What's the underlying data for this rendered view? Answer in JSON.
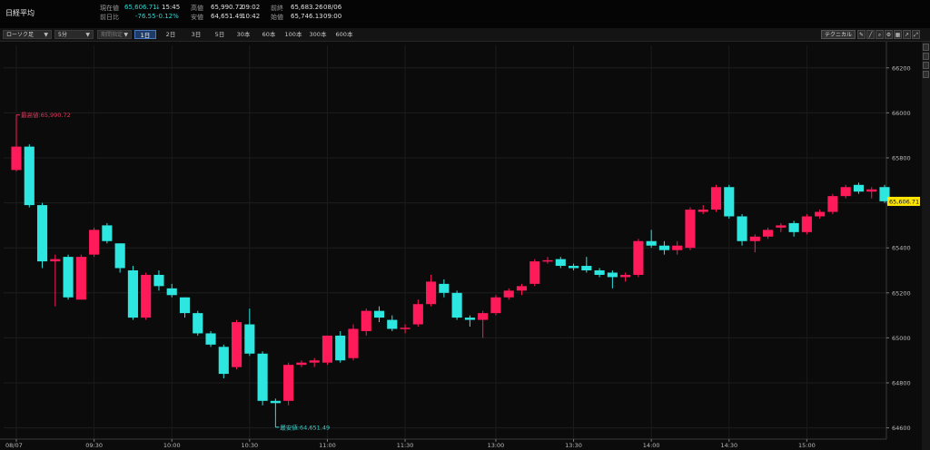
{
  "header": {
    "title": "日経平均",
    "current_label": "現在値",
    "current_value": "65,606.71",
    "current_arrow": "↓",
    "current_time": "15:45",
    "change_label": "前日比",
    "change_value": "-76.55",
    "change_pct": "-0.12%",
    "high_label": "高値",
    "high_value": "65,990.72",
    "high_time": "09:02",
    "low_label": "安値",
    "low_value": "64,651.49",
    "low_time": "10:42",
    "prev_label": "前終",
    "prev_value": "65,683.26",
    "prev_date": "08/06",
    "open_label": "始値",
    "open_value": "65,746.13",
    "open_time": "09:00"
  },
  "toolbar": {
    "chart_type": "ローソク足",
    "interval": "5分",
    "compare": "期間指定",
    "timeframes": [
      "1日",
      "2日",
      "3日",
      "5日",
      "30本",
      "60本",
      "100本",
      "300本",
      "600本"
    ],
    "active_timeframe": "1日",
    "technical_label": "テクニカル",
    "tool_icons": [
      "pencil-icon",
      "ruler-icon",
      "zoom-icon",
      "settings-icon",
      "bar-chart-icon",
      "line-chart-icon",
      "expand-icon"
    ]
  },
  "colors": {
    "up": "#ff1a5a",
    "down": "#2ee6e0",
    "background": "#0b0b0b",
    "price_label_bg": "#ffe600",
    "high_annotation": "#e4365c",
    "low_annotation": "#34d6d1"
  },
  "chart_data": {
    "type": "candlestick",
    "interval": "5分",
    "ylim": [
      64550,
      66300
    ],
    "yticks": [
      64600,
      64800,
      65000,
      65200,
      65400,
      65600,
      65800,
      66000,
      66200
    ],
    "ytick_labels": [
      "64600",
      "64800",
      "65000",
      "65200",
      "65400",
      "65600",
      "65800",
      "66000",
      "66200"
    ],
    "xtick_labels": [
      {
        "label": "08/07",
        "index": 0
      },
      {
        "label": "09:30",
        "index": 6
      },
      {
        "label": "10:00",
        "index": 12
      },
      {
        "label": "10:30",
        "index": 18
      },
      {
        "label": "11:00",
        "index": 24
      },
      {
        "label": "11:30",
        "index": 30
      },
      {
        "label": "13:00",
        "index": 37
      },
      {
        "label": "13:30",
        "index": 43
      },
      {
        "label": "14:00",
        "index": 49
      },
      {
        "label": "14:30",
        "index": 55
      },
      {
        "label": "15:00",
        "index": 61
      }
    ],
    "candles": [
      {
        "time": "09:00",
        "o": 65746,
        "h": 65991,
        "l": 65740,
        "c": 65850
      },
      {
        "time": "09:05",
        "o": 65850,
        "h": 65860,
        "l": 65580,
        "c": 65590
      },
      {
        "time": "09:10",
        "o": 65590,
        "h": 65600,
        "l": 65310,
        "c": 65340
      },
      {
        "time": "09:15",
        "o": 65340,
        "h": 65370,
        "l": 65140,
        "c": 65350
      },
      {
        "time": "09:20",
        "o": 65360,
        "h": 65370,
        "l": 65170,
        "c": 65180
      },
      {
        "time": "09:25",
        "o": 65170,
        "h": 65370,
        "l": 65170,
        "c": 65360
      },
      {
        "time": "09:30",
        "o": 65370,
        "h": 65490,
        "l": 65360,
        "c": 65480
      },
      {
        "time": "09:35",
        "o": 65500,
        "h": 65510,
        "l": 65420,
        "c": 65430
      },
      {
        "time": "09:40",
        "o": 65420,
        "h": 65420,
        "l": 65290,
        "c": 65310
      },
      {
        "time": "09:45",
        "o": 65300,
        "h": 65320,
        "l": 65080,
        "c": 65090
      },
      {
        "time": "09:50",
        "o": 65090,
        "h": 65290,
        "l": 65080,
        "c": 65280
      },
      {
        "time": "09:55",
        "o": 65280,
        "h": 65300,
        "l": 65210,
        "c": 65230
      },
      {
        "time": "10:00",
        "o": 65220,
        "h": 65240,
        "l": 65180,
        "c": 65190
      },
      {
        "time": "10:05",
        "o": 65180,
        "h": 65180,
        "l": 65090,
        "c": 65110
      },
      {
        "time": "10:10",
        "o": 65110,
        "h": 65120,
        "l": 65010,
        "c": 65020
      },
      {
        "time": "10:15",
        "o": 65020,
        "h": 65030,
        "l": 64960,
        "c": 64970
      },
      {
        "time": "10:20",
        "o": 64960,
        "h": 64970,
        "l": 64820,
        "c": 64840
      },
      {
        "time": "10:25",
        "o": 64870,
        "h": 65080,
        "l": 64860,
        "c": 65070
      },
      {
        "time": "10:30",
        "o": 65060,
        "h": 65130,
        "l": 64920,
        "c": 64930
      },
      {
        "time": "10:35",
        "o": 64930,
        "h": 64940,
        "l": 64700,
        "c": 64720
      },
      {
        "time": "10:40",
        "o": 64720,
        "h": 64730,
        "l": 64651,
        "c": 64710
      },
      {
        "time": "10:45",
        "o": 64720,
        "h": 64890,
        "l": 64700,
        "c": 64880
      },
      {
        "time": "10:50",
        "o": 64880,
        "h": 64900,
        "l": 64870,
        "c": 64890
      },
      {
        "time": "10:55",
        "o": 64890,
        "h": 64910,
        "l": 64870,
        "c": 64900
      },
      {
        "time": "11:00",
        "o": 64890,
        "h": 65010,
        "l": 64880,
        "c": 65010
      },
      {
        "time": "11:05",
        "o": 65010,
        "h": 65030,
        "l": 64890,
        "c": 64900
      },
      {
        "time": "11:10",
        "o": 64910,
        "h": 65060,
        "l": 64900,
        "c": 65040
      },
      {
        "time": "11:15",
        "o": 65030,
        "h": 65130,
        "l": 65010,
        "c": 65120
      },
      {
        "time": "11:20",
        "o": 65120,
        "h": 65140,
        "l": 65070,
        "c": 65090
      },
      {
        "time": "11:25",
        "o": 65080,
        "h": 65100,
        "l": 65030,
        "c": 65040
      },
      {
        "time": "11:30",
        "o": 65040,
        "h": 65060,
        "l": 65020,
        "c": 65045
      },
      {
        "time": "12:30",
        "o": 65060,
        "h": 65170,
        "l": 65050,
        "c": 65150
      },
      {
        "time": "12:35",
        "o": 65150,
        "h": 65280,
        "l": 65140,
        "c": 65250
      },
      {
        "time": "12:40",
        "o": 65240,
        "h": 65260,
        "l": 65180,
        "c": 65200
      },
      {
        "time": "12:45",
        "o": 65200,
        "h": 65210,
        "l": 65080,
        "c": 65090
      },
      {
        "time": "12:50",
        "o": 65090,
        "h": 65100,
        "l": 65050,
        "c": 65080
      },
      {
        "time": "12:55",
        "o": 65080,
        "h": 65120,
        "l": 65000,
        "c": 65110
      },
      {
        "time": "13:00",
        "o": 65110,
        "h": 65190,
        "l": 65100,
        "c": 65180
      },
      {
        "time": "13:05",
        "o": 65180,
        "h": 65220,
        "l": 65170,
        "c": 65210
      },
      {
        "time": "13:10",
        "o": 65210,
        "h": 65240,
        "l": 65190,
        "c": 65230
      },
      {
        "time": "13:15",
        "o": 65240,
        "h": 65350,
        "l": 65230,
        "c": 65340
      },
      {
        "time": "13:20",
        "o": 65340,
        "h": 65360,
        "l": 65330,
        "c": 65345
      },
      {
        "time": "13:25",
        "o": 65350,
        "h": 65360,
        "l": 65310,
        "c": 65320
      },
      {
        "time": "13:30",
        "o": 65320,
        "h": 65330,
        "l": 65300,
        "c": 65310
      },
      {
        "time": "13:35",
        "o": 65320,
        "h": 65360,
        "l": 65290,
        "c": 65300
      },
      {
        "time": "13:40",
        "o": 65300,
        "h": 65310,
        "l": 65270,
        "c": 65280
      },
      {
        "time": "13:45",
        "o": 65290,
        "h": 65300,
        "l": 65220,
        "c": 65270
      },
      {
        "time": "13:50",
        "o": 65270,
        "h": 65290,
        "l": 65250,
        "c": 65280
      },
      {
        "time": "13:55",
        "o": 65280,
        "h": 65440,
        "l": 65270,
        "c": 65430
      },
      {
        "time": "14:00",
        "o": 65430,
        "h": 65480,
        "l": 65400,
        "c": 65410
      },
      {
        "time": "14:05",
        "o": 65410,
        "h": 65430,
        "l": 65370,
        "c": 65390
      },
      {
        "time": "14:10",
        "o": 65390,
        "h": 65430,
        "l": 65370,
        "c": 65410
      },
      {
        "time": "14:15",
        "o": 65400,
        "h": 65580,
        "l": 65390,
        "c": 65570
      },
      {
        "time": "14:20",
        "o": 65560,
        "h": 65590,
        "l": 65550,
        "c": 65570
      },
      {
        "time": "14:25",
        "o": 65570,
        "h": 65680,
        "l": 65560,
        "c": 65670
      },
      {
        "time": "14:30",
        "o": 65670,
        "h": 65680,
        "l": 65530,
        "c": 65540
      },
      {
        "time": "14:35",
        "o": 65540,
        "h": 65550,
        "l": 65410,
        "c": 65430
      },
      {
        "time": "14:40",
        "o": 65430,
        "h": 65460,
        "l": 65380,
        "c": 65450
      },
      {
        "time": "14:45",
        "o": 65450,
        "h": 65490,
        "l": 65440,
        "c": 65480
      },
      {
        "time": "14:50",
        "o": 65490,
        "h": 65510,
        "l": 65470,
        "c": 65500
      },
      {
        "time": "14:55",
        "o": 65510,
        "h": 65520,
        "l": 65450,
        "c": 65470
      },
      {
        "time": "15:00",
        "o": 65470,
        "h": 65550,
        "l": 65460,
        "c": 65540
      },
      {
        "time": "15:05",
        "o": 65540,
        "h": 65570,
        "l": 65530,
        "c": 65560
      },
      {
        "time": "15:10",
        "o": 65560,
        "h": 65640,
        "l": 65550,
        "c": 65630
      },
      {
        "time": "15:15",
        "o": 65630,
        "h": 65680,
        "l": 65620,
        "c": 65670
      },
      {
        "time": "15:20",
        "o": 65680,
        "h": 65690,
        "l": 65640,
        "c": 65650
      },
      {
        "time": "15:25",
        "o": 65650,
        "h": 65670,
        "l": 65620,
        "c": 65660
      },
      {
        "time": "15:30",
        "o": 65670,
        "h": 65680,
        "l": 65600,
        "c": 65607
      }
    ],
    "high_marker": {
      "label": "最高値:65,990.72",
      "value": 65990.72,
      "index": 0
    },
    "low_marker": {
      "label": "最安値:64,651.49",
      "value": 64651.49,
      "index": 20
    },
    "last_price_label": "65,606.71",
    "last_price": 65606.71,
    "grid": true,
    "legend": "none"
  }
}
